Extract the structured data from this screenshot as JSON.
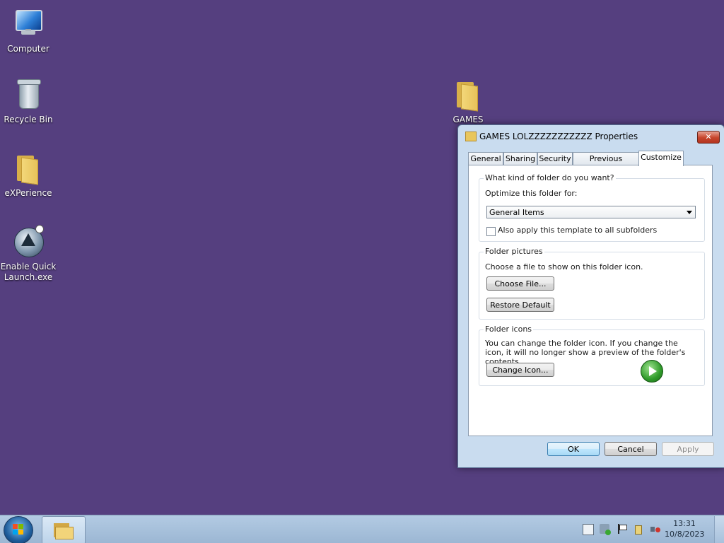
{
  "desktop": {
    "icons": [
      {
        "label": "Computer",
        "icon": "computer-icon"
      },
      {
        "label": "Recycle Bin",
        "icon": "recycle-bin-icon"
      },
      {
        "label": "eXPerience",
        "icon": "folder-icon"
      },
      {
        "label": "Enable Quick Launch.exe",
        "icon": "aim-app-icon"
      },
      {
        "label": "GAMES LOL",
        "icon": "folder-icon"
      }
    ]
  },
  "dialog": {
    "title": "GAMES LOLZZZZZZZZZZZ Properties",
    "close_label": "✕",
    "tabs": [
      {
        "label": "General"
      },
      {
        "label": "Sharing"
      },
      {
        "label": "Security"
      },
      {
        "label": "Previous Versions"
      },
      {
        "label": "Customize"
      }
    ],
    "active_tab": "Customize",
    "folder_type": {
      "group_title": "What kind of folder do you want?",
      "optimize_label": "Optimize this folder for:",
      "selected_value": "General Items",
      "apply_subfolders_label": "Also apply this template to all subfolders",
      "apply_subfolders_checked": false
    },
    "folder_pictures": {
      "group_title": "Folder pictures",
      "description": "Choose a file to show on this folder icon.",
      "choose_file_label": "Choose File...",
      "restore_default_label": "Restore Default"
    },
    "folder_icons": {
      "group_title": "Folder icons",
      "description": "You can change the folder icon. If you change the icon, it will no longer show a preview of the folder's contents.",
      "change_icon_label": "Change Icon..."
    },
    "buttons": {
      "ok": "OK",
      "cancel": "Cancel",
      "apply": "Apply"
    }
  },
  "taskbar": {
    "clock_time": "13:31",
    "clock_date": "10/8/2023",
    "tray_icons": [
      "action-center-icon",
      "network-icon",
      "flag-icon",
      "power-icon",
      "volume-muted-icon"
    ]
  }
}
